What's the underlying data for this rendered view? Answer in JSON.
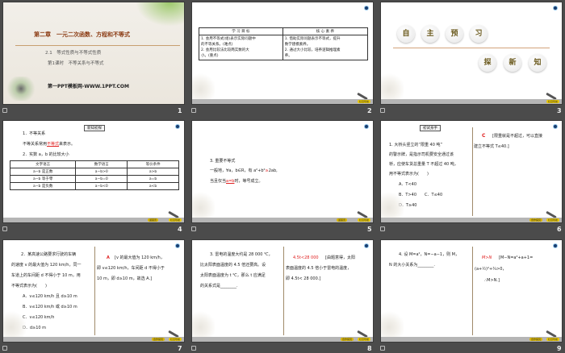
{
  "slides": [
    {
      "number": "1",
      "chapter": "第二章　一元二次函数、方程和不等式",
      "section": "2.1　等式性质与不等式性质",
      "lesson": "第1课时　不等关系与不等式",
      "watermark": "第一PPT模板网-WWW.1PPT.COM"
    },
    {
      "number": "2",
      "headers": [
        "学 习 目 标",
        "核 心 素 养"
      ],
      "left": [
        "1. 会用不等式(组)表示实际问题中",
        "的不等关系。(难点)",
        "2. 会用比较法比较两实数的大",
        "小。(重点)"
      ],
      "right": [
        "1. 借助实际问题表示不等式，提升",
        "数学建模素养。",
        "2. 通过大小比较，培养逻辑推理素",
        "养。"
      ],
      "buttons": [
        "栏目导航"
      ]
    },
    {
      "number": "3",
      "top": [
        "自",
        "主",
        "预",
        "习"
      ],
      "bottom": [
        "探",
        "新",
        "知"
      ],
      "buttons": [
        "栏目导航"
      ]
    },
    {
      "number": "4",
      "heading": "新知初探",
      "l1": "1．不等关系",
      "l2a": "不等关系常用",
      "l2b": "不等式",
      "l2c": "来表示。",
      "l3": "2．实数 a，b 的比较大小",
      "table": [
        [
          "文字语言",
          "数学语言",
          "等价条件"
        ],
        [
          "a−b 是正数",
          "a−b>0",
          "a>b"
        ],
        [
          "a−b 等于零",
          "a−b=0",
          "a=b"
        ],
        [
          "a−b 是负数",
          "a−b<0",
          "a<b"
        ]
      ],
      "buttons": [
        "返首页",
        "栏目导航"
      ]
    },
    {
      "number": "5",
      "l1": "3. 重要不等式",
      "l2a": "一般地，∀a，b∈R，有 a²+b²",
      "l2b": "≥",
      "l2c": "2ab,",
      "l3a": "当且仅当",
      "l3b": "a=b",
      "l3c": "时，等号成立。",
      "buttons": [
        "返首页",
        "栏目导航"
      ]
    },
    {
      "number": "6",
      "heading": "初试身手",
      "q": [
        "1. 大桥头竖立的“限重 40 吨”",
        "的警示牌，是指示司机要安全通过该",
        "桥，应使车货总重量 T 不超过 40 吨，",
        "用不等式表示为(　　)"
      ],
      "opts": [
        "A．T<40",
        "B．T>40　　C．T≤40",
        "D．T≥40"
      ],
      "ans": "C",
      "exp": [
        "[限重就是不超过，可以直接",
        "建立不等式 T≤40.]"
      ],
      "buttons": [
        "合作探究",
        "栏目导航"
      ]
    },
    {
      "number": "7",
      "q": [
        "2．某高速公路要求行驶的车辆",
        "的速度 v 的最大值为 120 km/h，同一",
        "车道上的车间距 d 不得小于 10 m，用",
        "不等式表示为(　　)"
      ],
      "opts": [
        "A．v≤120 km/h 且 d≥10 m",
        "B．v≤120 km/h 或 d≥10 m",
        "C．v≤120 km/h",
        "D．d≥10 m"
      ],
      "ans": "A",
      "exp": [
        "[v 的最大值为 120 km/h，",
        "即 v≤120 km/h，车间距 d 不得小于",
        "10 m，即 d≥10 m，故选 A.]"
      ],
      "buttons": [
        "合作探究",
        "栏目导航"
      ]
    },
    {
      "number": "8",
      "q": [
        "3. 雷电的温度大约是 28 000 ℃，",
        "比太阳表面温度的 4.5 倍还要高。设",
        "太阳表面温度为 t ℃，那么 t 应满足",
        "的关系式是________."
      ],
      "ans": "4.5t<28 000",
      "exp": [
        "[由题意得，太阳",
        "表面温度的 4.5 倍小于雷电的温度，",
        "即 4.5t< 28 000.]"
      ],
      "buttons": [
        "合作探究",
        "栏目导航"
      ]
    },
    {
      "number": "9",
      "q": [
        "4. 设 M=a²，N=−a−1，则 M，",
        "N 的大小关系为________."
      ],
      "ans": "M>N",
      "exp": [
        "[M−N=a²+a+1=",
        "(a+½)²+¾>0，",
        "∴M>N.]"
      ],
      "buttons": [
        "合作探究",
        "栏目导航"
      ]
    }
  ],
  "transition_icon": "transition-star-icon"
}
